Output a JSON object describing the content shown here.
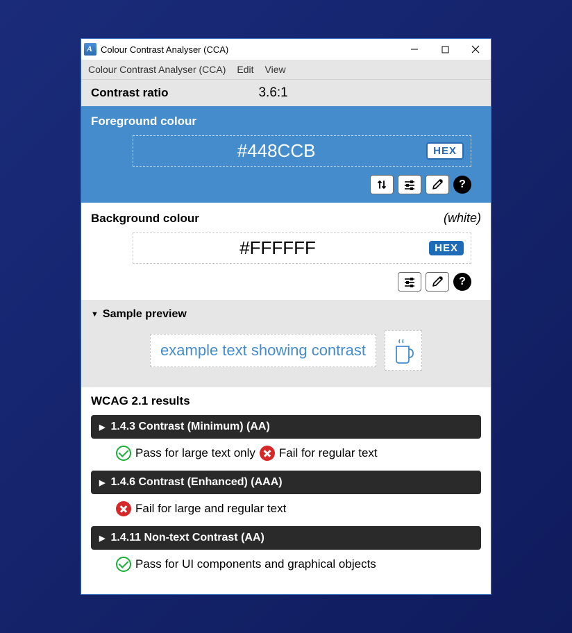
{
  "window": {
    "title": "Colour Contrast Analyser (CCA)"
  },
  "menu": {
    "app": "Colour Contrast Analyser (CCA)",
    "edit": "Edit",
    "view": "View"
  },
  "ratio": {
    "label": "Contrast ratio",
    "value": "3.6:1"
  },
  "foreground": {
    "heading": "Foreground colour",
    "value": "#448CCB",
    "format": "HEX"
  },
  "background": {
    "heading": "Background colour",
    "colorname": "(white)",
    "value": "#FFFFFF",
    "format": "HEX"
  },
  "preview": {
    "heading": "Sample preview",
    "text": "example text showing contrast"
  },
  "results": {
    "heading": "WCAG 2.1 results",
    "items": [
      {
        "title": "1.4.3 Contrast (Minimum) (AA)",
        "pass_text": "Pass for large text only",
        "fail_text": "Fail for regular text",
        "has_pass": true,
        "has_fail": true
      },
      {
        "title": "1.4.6 Contrast (Enhanced) (AAA)",
        "fail_text": "Fail for large and regular text",
        "has_pass": false,
        "has_fail": true
      },
      {
        "title": "1.4.11 Non-text Contrast (AA)",
        "pass_text": "Pass for UI components and graphical objects",
        "has_pass": true,
        "has_fail": false
      }
    ]
  }
}
